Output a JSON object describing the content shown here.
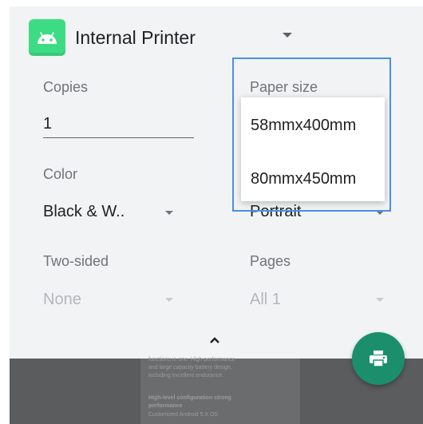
{
  "header": {
    "printer_name": "Internal Printer",
    "icon": "android-icon"
  },
  "copies": {
    "label": "Copies",
    "value": "1"
  },
  "paper_size": {
    "label": "Paper size",
    "options": [
      "58mmx400mm",
      "80mmx450mm"
    ]
  },
  "color": {
    "label": "Color",
    "value": "Black & W.."
  },
  "orientation": {
    "value": "Portrait"
  },
  "two_sided": {
    "label": "Two-sided",
    "value": "None"
  },
  "pages": {
    "label": "Pages",
    "value": "All 1"
  },
  "preview": {
    "lines": [
      "functions in one. High performance",
      "and large capacity battery design,",
      "including excellent endurance.",
      "",
      "High-level configuration strong",
      "performance",
      "Customized Android 5.X OS"
    ]
  },
  "colors": {
    "accent": "#1b8f6b",
    "android": "#3ddc84",
    "highlight": "#4a90e2"
  }
}
